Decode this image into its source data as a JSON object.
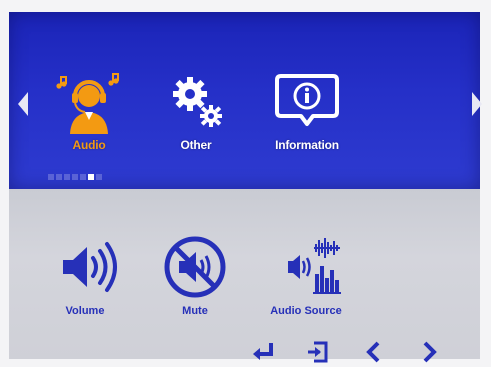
{
  "menu": {
    "items": [
      {
        "label": "Audio",
        "icon": "headset-user-icon",
        "active": true
      },
      {
        "label": "Other",
        "icon": "gears-icon",
        "active": false
      },
      {
        "label": "Information",
        "icon": "info-bubble-icon",
        "active": false
      }
    ],
    "page_indicator": {
      "count": 7,
      "active_index": 5
    }
  },
  "submenu": {
    "items": [
      {
        "label": "Volume",
        "icon": "speaker-volume-icon"
      },
      {
        "label": "Mute",
        "icon": "mute-icon"
      },
      {
        "label": "Audio Source",
        "icon": "audio-source-icon"
      }
    ]
  },
  "nav_keys": [
    "enter-icon",
    "exit-icon",
    "left-icon",
    "right-icon"
  ],
  "colors": {
    "menu_bg": "#2530c8",
    "submenu_bg": "#d0d1d8",
    "accent": "#f39a12",
    "icon_blue": "#2630b8"
  }
}
